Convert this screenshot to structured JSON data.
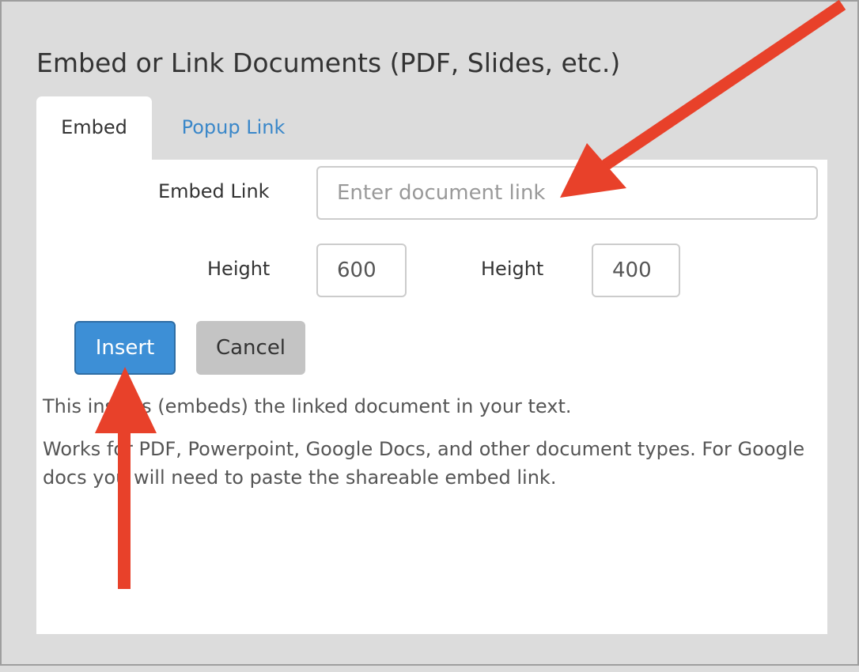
{
  "dialog": {
    "title": "Embed or Link Documents (PDF, Slides, etc.)"
  },
  "tabs": [
    {
      "label": "Embed",
      "active": true
    },
    {
      "label": "Popup Link",
      "active": false
    }
  ],
  "form": {
    "embed_link_label": "Embed Link",
    "embed_link_placeholder": "Enter document link",
    "embed_link_value": "",
    "height_label_1": "Height",
    "height_value_1": "600",
    "height_label_2": "Height",
    "height_value_2": "400"
  },
  "buttons": {
    "insert_label": "Insert",
    "cancel_label": "Cancel"
  },
  "help": {
    "line1": "This inserts (embeds) the linked document in your text.",
    "line2": "Works for PDF, Powerpoint, Google Docs, and other document types. For Google docs you will need to paste the shareable embed link."
  },
  "colors": {
    "accent": "#3d8fd6",
    "link": "#3a87c9",
    "annotation_arrow": "#e8412a",
    "dialog_background": "#dcdcdc"
  }
}
